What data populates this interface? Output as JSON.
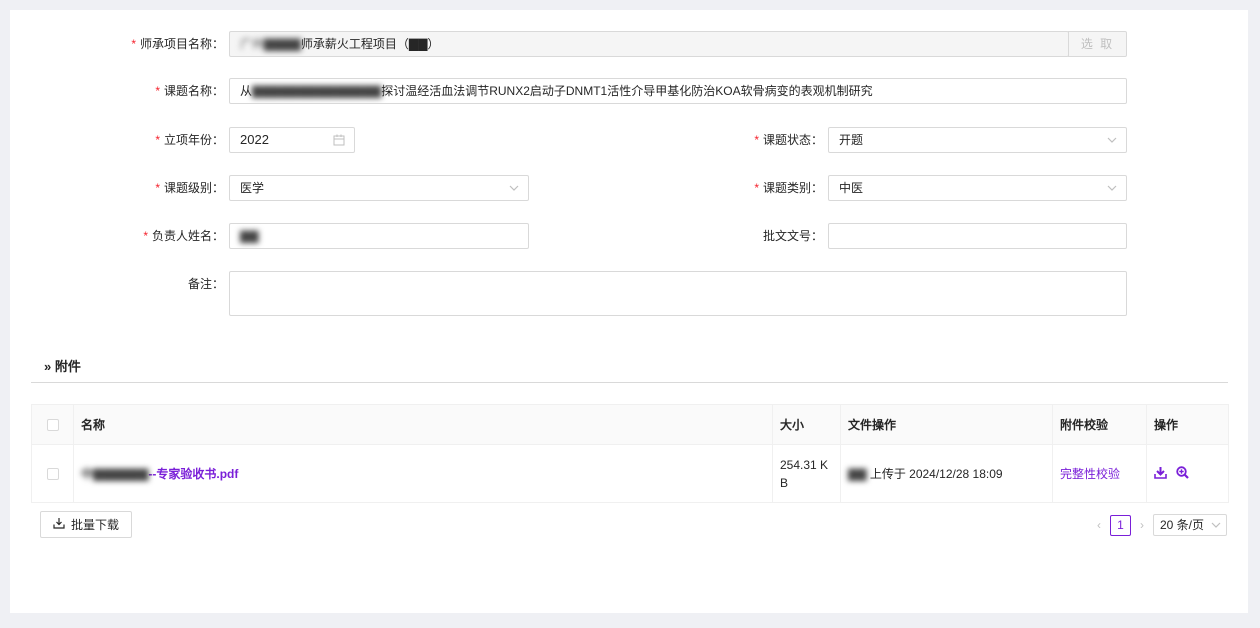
{
  "form": {
    "project": {
      "label": "师承项目名称：",
      "value_obscured": "广州▇▇▇▇",
      "value": "师承薪火工程项目（▇▇）",
      "pick_button": "选 取"
    },
    "topic_name": {
      "label": "课题名称：",
      "prefix": "从",
      "obscured": "▇▇▇▇▇▇▇▇▇▇▇▇▇▇",
      "value": "探讨温经活血法调节RUNX2启动子DNMT1活性介导甲基化防治KOA软骨病变的表观机制研究"
    },
    "year": {
      "label": "立项年份：",
      "value": "2022",
      "icon": "calendar-icon"
    },
    "status": {
      "label": "课题状态：",
      "value": "开题",
      "icon": "chevron-down-icon"
    },
    "level": {
      "label": "课题级别：",
      "value": "医学",
      "icon": "chevron-down-icon"
    },
    "category": {
      "label": "课题类别：",
      "value": "中医",
      "icon": "chevron-down-icon"
    },
    "leader": {
      "label": "负责人姓名：",
      "value_obscured": "▇▇"
    },
    "approval_no": {
      "label": "批文文号：",
      "value": ""
    },
    "remarks": {
      "label": "备注：",
      "value": ""
    }
  },
  "attachments": {
    "section_title": "附件",
    "columns": {
      "name": "名称",
      "size": "大小",
      "file_ops": "文件操作",
      "verify": "附件校验",
      "ops": "操作"
    },
    "rows": [
      {
        "name_obscured": "中▇▇▇▇▇▇",
        "name": "--专家验收书.pdf",
        "size": "254.31 KB",
        "uploader_obscured": "▇▇",
        "upload_text": "上传于 2024/12/28 18:09",
        "verify": "完整性校验",
        "download_icon": "download-icon",
        "preview_icon": "zoom-in-icon"
      }
    ]
  },
  "footer": {
    "batch_download": "批量下载",
    "current_page": "1",
    "page_size": "20 条/页"
  },
  "colors": {
    "accent": "#7a1fd8",
    "required": "#f5222d",
    "background": "#eff0f4"
  }
}
